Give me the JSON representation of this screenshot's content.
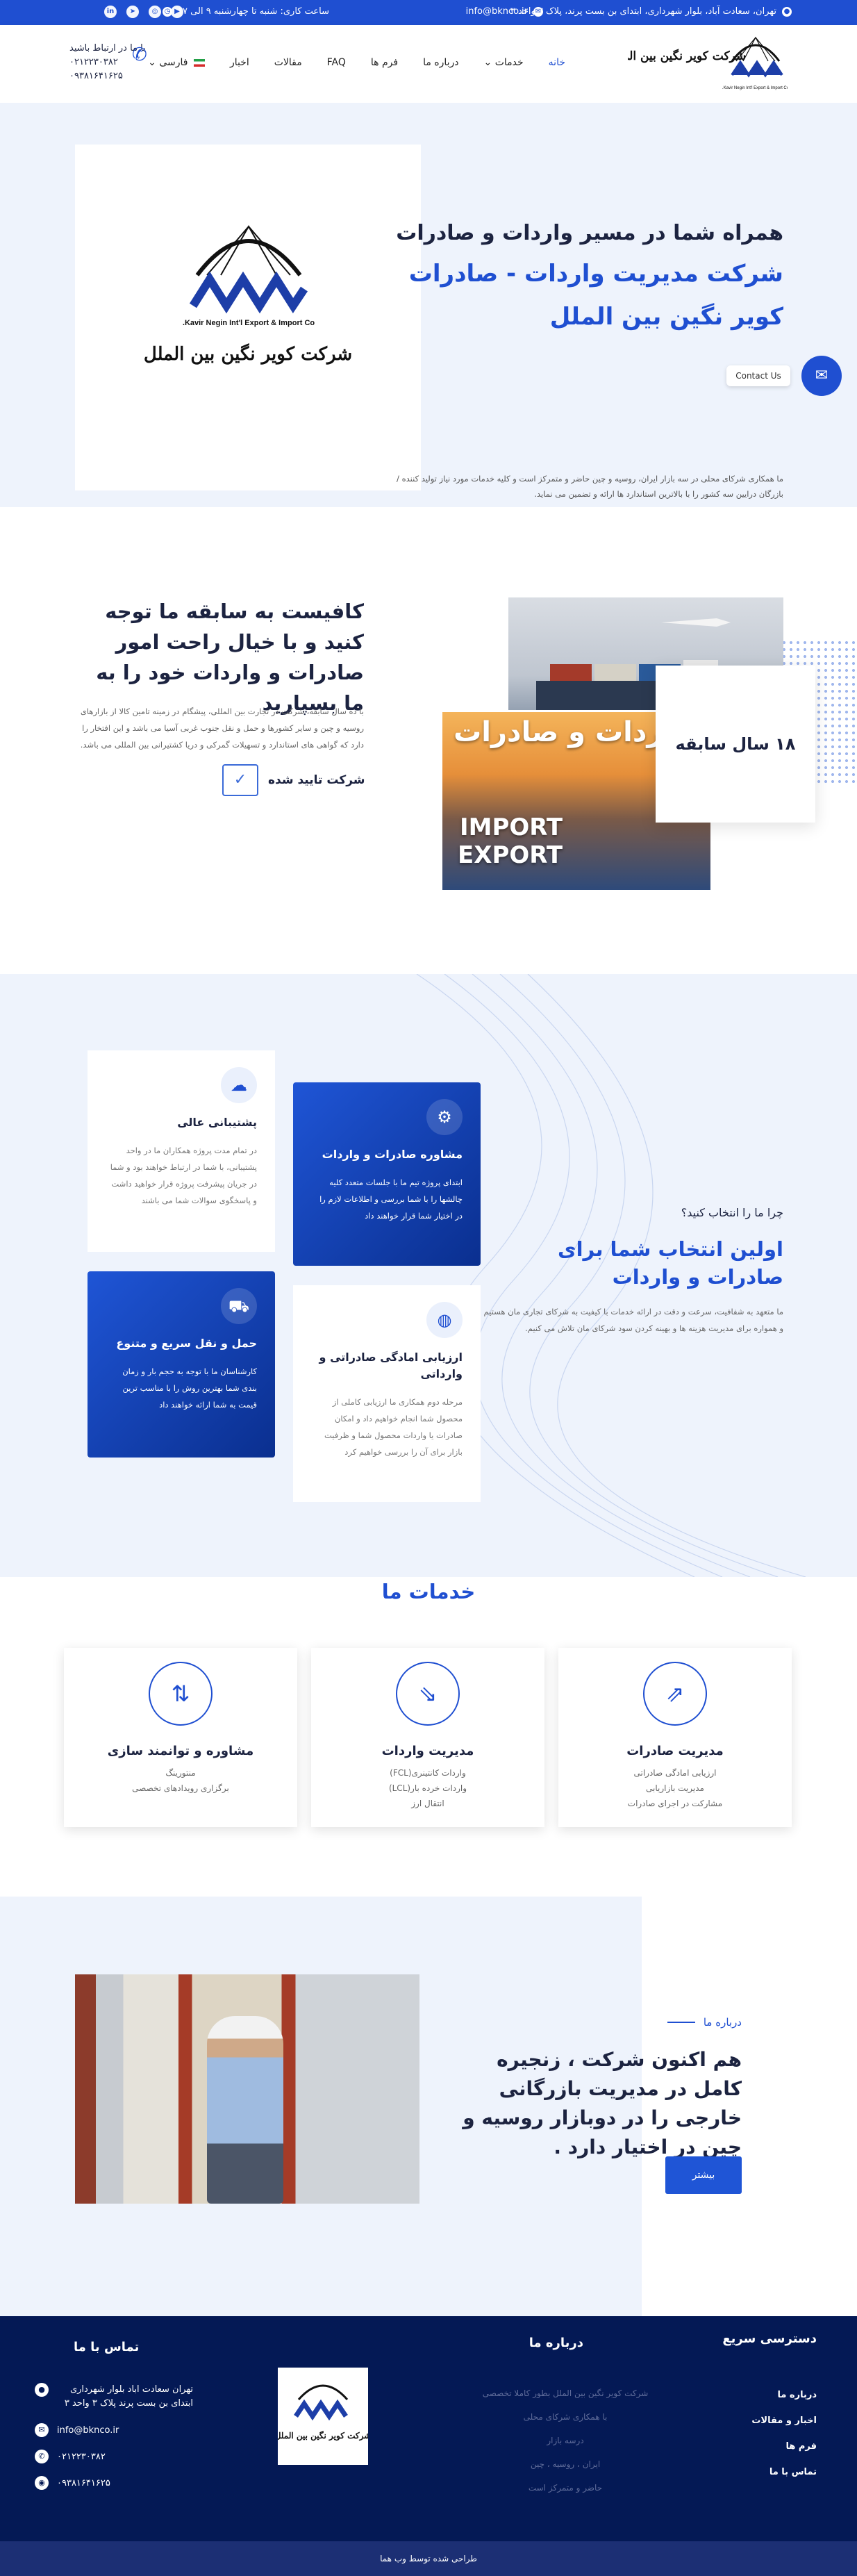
{
  "topbar": {
    "address": "تهران، سعادت آباد، بلوار شهرداری، ابتدای بن بست پرند، پلاک ۳ واحد ۳",
    "email": "info@bknco.ir",
    "hours": "ساعت کاری: شنبه تا چهارشنبه ۹ الی ۱۷",
    "social": [
      "youtube-icon",
      "instagram-icon",
      "telegram-icon",
      "linkedin-icon"
    ]
  },
  "header": {
    "logo_caption": "Kavir Negin Int'l Export & Import Co.",
    "logo_script": "شرکت کویر نگین بین الملل",
    "nav": [
      "خانه",
      "خدمات",
      "درباره ما",
      "فرم ها",
      "FAQ",
      "مقالات",
      "اخبار",
      "فارسی"
    ],
    "phone_label": "با ما در ارتباط باشید",
    "phone1": "۰۲۱۲۲۳۰۳۸۲",
    "phone2": "۰۹۳۸۱۶۴۱۶۲۵"
  },
  "hero": {
    "line1": "همراه شما در مسیر واردات و صادرات",
    "line2": "شرکت مدیریت واردات - صادرات",
    "line3": "کویر نگین بین الملل",
    "desc": "ما همکاری شرکای محلی در سه بازار ایران، روسیه و چین حاضر و متمرکز است و کلیه خدمات مورد نیاز تولید کننده / بازرگان درایین سه کشور را با بالاترین استاندارد ها ارائه و تضمین می نماید.",
    "contact_label": "Contact Us"
  },
  "experience": {
    "title": "کافیست به سابقه ما توجه کنید و با خیال راحت امور صادرات و واردات خود را به ما بسپارید",
    "desc": "با ده سال سابقه، شرکت در تجارت بین المللی، پیشگام در زمینه تامین کالا از بازارهای روسیه و چین و سایر کشورها و حمل و نقل جنوب غربی آسیا می باشد و این افتخار را دارد که گواهی های استاندارد و تسهیلات گمرکی و دریا کشتیرانی بین المللی می باشد.",
    "verified": "شرکت تایید شده",
    "badge": "۱۸ سال سابقه",
    "img_title": "واردات و صادرات",
    "img_en1": "IMPORT",
    "img_en2": "EXPORT"
  },
  "why": {
    "kicker": "چرا ما را انتخاب کنید؟",
    "title": "اولین انتخاب شما برای صادرات و واردات",
    "desc": "ما متعهد به شفافیت، سرعت و دقت در ارائه خدمات با کیفیت به شرکای تجاری مان هستیم و همواره برای مدیریت هزینه ها و بهینه کردن سود شرکای مان تلاش می کنیم.",
    "cards": [
      {
        "title": "مشاوره صادرات و واردات",
        "text": "ابتدای پروژه تیم ما با جلسات متعدد کلیه چالشها را با شما بررسی و اطلاعات لازم را در اختیار شما قرار خواهند داد",
        "icon": "gear-icon"
      },
      {
        "title": "پشتیبانی عالی",
        "text": "در تمام مدت پروژه همکاران ما در واحد پشتیبانی، با شما در ارتباط خواهند بود و شما در جریان پیشرفت پروژه قرار خواهید داشت و پاسخگوی سوالات شما می باشند",
        "icon": "support-icon"
      },
      {
        "title": "ارزیابی امادگی صادراتی و وارداتی",
        "text": "مرحله دوم همکاری ما ارزیابی کاملی از محصول شما انجام خواهیم داد و امکان صادرات یا واردات محصول شما و ظرفیت بازار برای آن را بررسی خواهیم کرد",
        "icon": "globe-icon"
      },
      {
        "title": "حمل و نقل سریع و متنوع",
        "text": "کارشناسان ما با توجه به حجم بار و زمان بندی شما بهترین روش را با مناسب ترین قیمت به شما ارائه خواهند داد",
        "icon": "truck-icon"
      }
    ]
  },
  "services": {
    "title": "خدمات ما",
    "cards": [
      {
        "title": "مدیریت صادرات",
        "lines": [
          "ارزیابی امادگی صادراتی",
          "مدیریت بازاریابی",
          "مشارکت در اجرای صادرات"
        ],
        "icon": "export-icon"
      },
      {
        "title": "مدیریت واردات",
        "lines": [
          "واردات کانتینری(FCL)",
          "واردات خرده بار(LCL)",
          "انتقال ارز"
        ],
        "icon": "import-icon"
      },
      {
        "title": "مشاوره و توانمند سازی",
        "lines": [
          "منتورینگ",
          "برگزاری رویدادهای تخصصی"
        ],
        "icon": "arrows-icon"
      }
    ]
  },
  "about": {
    "kicker": "درباره ما",
    "title": "هم اکنون شرکت ، زنجیره کامل در مدیریت بازرگانی خارجی را در دوبازار روسیه و چین در اختیار دارد .",
    "button": "بیشتر"
  },
  "footer": {
    "quick_title": "دسترسی سریع",
    "quick_links": [
      "درباره ما",
      "اخبار و مقالات",
      "فرم ها",
      "تماس با ما"
    ],
    "about_title": "درباره ما",
    "about_lines": [
      "شرکت کویر نگین بین الملل بطور کاملا تخصصی",
      "با همکاری شرکای محلی",
      "درسه بازار",
      "ایران ، روسیه ، چین",
      "حاضر و متمرکز است"
    ],
    "contact_title": "تماس با ما",
    "address": "تهران سعادت اباد بلوار شهرداری ابتدای بن بست پرند پلاک ۳ واحد ۳",
    "email": "info@bknco.ir",
    "phone": "۰۲۱۲۲۳۰۳۸۲",
    "mobile": "۰۹۳۸۱۶۴۱۶۲۵",
    "copyright": "طراحی شده توسط وب هما"
  },
  "colors": {
    "primary": "#1f4fd1",
    "dark": "#041955",
    "bg_light": "#eef3fc"
  }
}
